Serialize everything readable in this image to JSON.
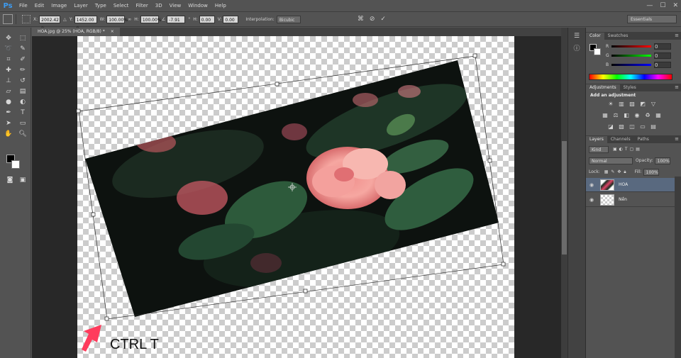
{
  "app": {
    "logo": "Ps"
  },
  "menu": [
    "File",
    "Edit",
    "Image",
    "Layer",
    "Type",
    "Select",
    "Filter",
    "3D",
    "View",
    "Window",
    "Help"
  ],
  "window_controls": [
    "—",
    "☐",
    "✕"
  ],
  "options": {
    "x_label": "X:",
    "x_value": "2002.42 p",
    "y_label": "Y:",
    "y_value": "1452.00 p",
    "w_label": "W:",
    "w_value": "100.00%",
    "h_label": "H:",
    "h_value": "100.00%",
    "angle_value": "-7.91",
    "hskew_label": "H:",
    "hskew_value": "0.00",
    "vskew_label": "V:",
    "vskew_value": "0.00",
    "interp_label": "Interpolation:",
    "interp_value": "Bicubic",
    "workspace": "Essentials"
  },
  "document": {
    "tab_title": "HOA.jpg @ 25% (HOA, RGB/8) *",
    "close": "×"
  },
  "annotation": {
    "label": "CTRL T",
    "arrow_color": "#ff3b5c"
  },
  "colors": {
    "fg": "#000000",
    "bg": "#ffffff",
    "selection": "#59697f",
    "brand": "#3d9bf0"
  },
  "panels": {
    "color_tabs": [
      "Color",
      "Swatches"
    ],
    "color_sliders": [
      {
        "label": "R",
        "value": "0"
      },
      {
        "label": "G",
        "value": "0"
      },
      {
        "label": "B",
        "value": "0"
      }
    ],
    "adj_tabs": [
      "Adjustments",
      "Styles"
    ],
    "adj_title": "Add an adjustment",
    "layers_tabs": [
      "Layers",
      "Channels",
      "Paths"
    ],
    "kind_label": "Kind",
    "blend_mode": "Normal",
    "opacity_label": "Opacity:",
    "opacity_value": "100%",
    "lock_label": "Lock:",
    "fill_label": "Fill:",
    "fill_value": "100%",
    "layers": [
      {
        "name": "HOA",
        "selected": true
      },
      {
        "name": "Nền",
        "selected": false
      }
    ]
  }
}
